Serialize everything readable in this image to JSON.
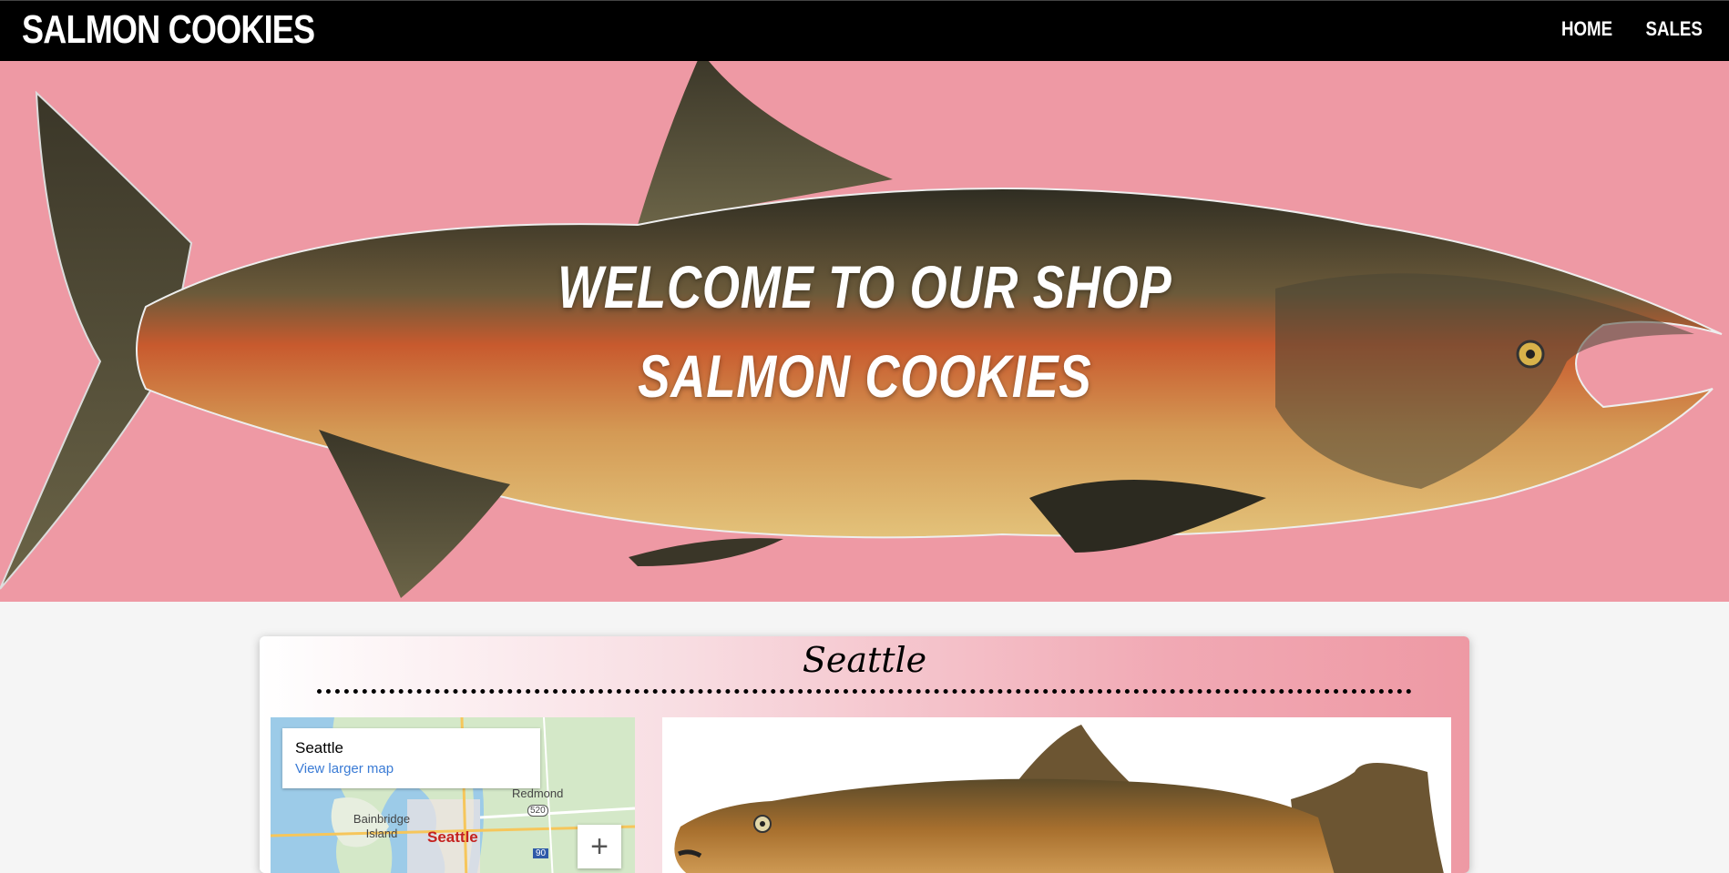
{
  "nav": {
    "logo": "SALMON COOKIES",
    "links": [
      {
        "label": "HOME"
      },
      {
        "label": "SALES"
      }
    ]
  },
  "hero": {
    "line1": "WELCOME TO OUR SHOP",
    "line2": "SALMON COOKIES",
    "background_color": "#ee99a4"
  },
  "store": {
    "name": "Seattle",
    "map": {
      "place": "Seattle",
      "link": "View larger map",
      "labels": {
        "redmond": "Redmond",
        "bainbridge": "Bainbridge Island",
        "city": "Seattle",
        "highway_520": "520",
        "highway_90": "90"
      },
      "zoom_in": "+"
    }
  },
  "colors": {
    "navbar": "#000000",
    "accent_pink": "#ee99a4",
    "link": "#3a7bd5"
  }
}
